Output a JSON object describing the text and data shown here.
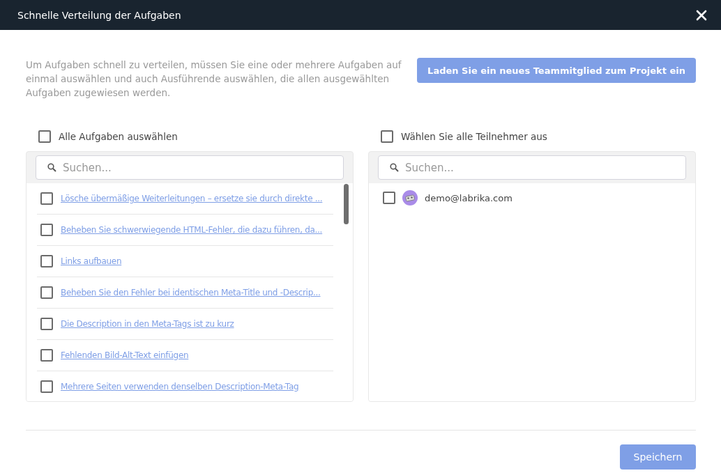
{
  "window": {
    "title": "Schnelle Verteilung der Aufgaben"
  },
  "description": "Um Aufgaben schnell zu verteilen, müssen Sie eine oder mehrere Aufgaben auf einmal auswählen und auch Ausführende auswählen, die allen ausgewählten Aufgaben zugewiesen werden.",
  "invite_button": "Laden Sie ein neues Teammitglied zum Projekt ein",
  "tasks_panel": {
    "select_all": {
      "label": "Alle Aufgaben auswählen",
      "checked": false
    },
    "search": {
      "placeholder": "Suchen..."
    },
    "items": [
      {
        "label": "Lösche übermäßige Weiterleitungen – ersetze sie durch direkte ...",
        "checked": false
      },
      {
        "label": "Beheben Sie schwerwiegende HTML-Fehler, die dazu führen, da...",
        "checked": false
      },
      {
        "label": "Links aufbauen",
        "checked": false
      },
      {
        "label": "Beheben Sie den Fehler bei identischen Meta-Title und -Descrip...",
        "checked": false
      },
      {
        "label": "Die Description in den Meta-Tags ist zu kurz",
        "checked": false
      },
      {
        "label": "Fehlenden Bild-Alt-Text einfügen",
        "checked": false
      },
      {
        "label": "Mehrere Seiten verwenden denselben Description-Meta-Tag",
        "checked": false
      }
    ]
  },
  "members_panel": {
    "select_all": {
      "label": "Wählen Sie alle Teilnehmer aus",
      "checked": false
    },
    "search": {
      "placeholder": "Suchen..."
    },
    "items": [
      {
        "email": "demo@labrika.com",
        "checked": false
      }
    ]
  },
  "save_button": "Speichern"
}
